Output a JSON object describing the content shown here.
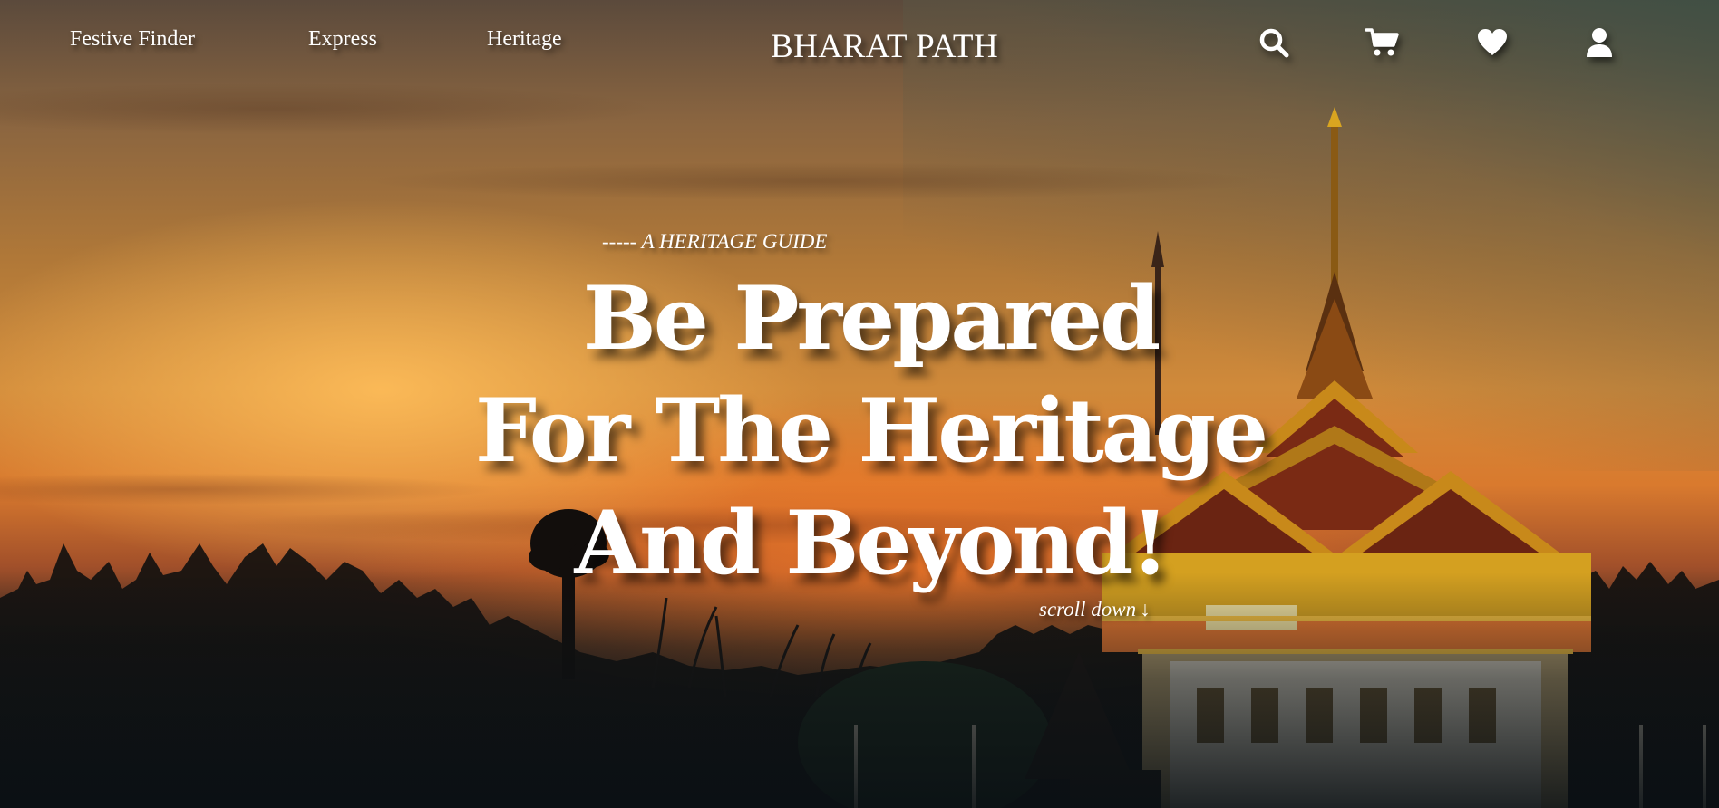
{
  "nav": {
    "links": [
      {
        "label": "Festive Finder"
      },
      {
        "label": "Express"
      },
      {
        "label": "Heritage"
      }
    ],
    "brand": "BHARAT PATH",
    "icons": [
      "search-icon",
      "cart-icon",
      "heart-icon",
      "user-icon"
    ]
  },
  "hero": {
    "eyebrow": "----- A HERITAGE GUIDE",
    "headline_lines": [
      "Be Prepared",
      "For The Heritage",
      "And Beyond!"
    ],
    "scroll_label": "scroll down",
    "scroll_arrow": "↓"
  },
  "colors": {
    "text": "#ffffff",
    "sky_gold": "#d08a3a",
    "sky_orange": "#d97a2e",
    "ground_dark": "#141a1f",
    "temple_gold": "#d9a520",
    "temple_red": "#8a2a1a"
  }
}
